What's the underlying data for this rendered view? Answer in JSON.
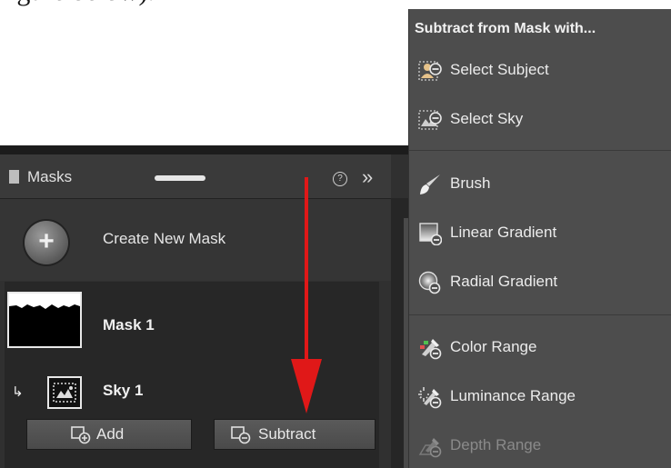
{
  "document": {
    "partial_text": "figure below)."
  },
  "masks_panel": {
    "title": "Masks",
    "help_icon": "?",
    "expand_icon": "»",
    "create_new_mask_label": "Create New Mask",
    "masks": [
      {
        "name": "Mask 1"
      },
      {
        "name": "Sky 1"
      }
    ],
    "add_button_label": "Add",
    "subtract_button_label": "Subtract"
  },
  "subtract_menu": {
    "title": "Subtract from Mask with...",
    "groups": [
      [
        {
          "label": "Select Subject",
          "icon": "select-subject-icon",
          "enabled": true
        },
        {
          "label": "Select Sky",
          "icon": "select-sky-icon",
          "enabled": true
        }
      ],
      [
        {
          "label": "Brush",
          "icon": "brush-icon",
          "enabled": true
        },
        {
          "label": "Linear Gradient",
          "icon": "linear-gradient-icon",
          "enabled": true
        },
        {
          "label": "Radial Gradient",
          "icon": "radial-gradient-icon",
          "enabled": true
        }
      ],
      [
        {
          "label": "Color Range",
          "icon": "color-range-icon",
          "enabled": true
        },
        {
          "label": "Luminance Range",
          "icon": "luminance-range-icon",
          "enabled": true
        },
        {
          "label": "Depth Range",
          "icon": "depth-range-icon",
          "enabled": false
        }
      ]
    ]
  },
  "colors": {
    "annotation_arrow": "#e01818",
    "panel_background": "#303030",
    "menu_background": "#4d4d4d"
  }
}
